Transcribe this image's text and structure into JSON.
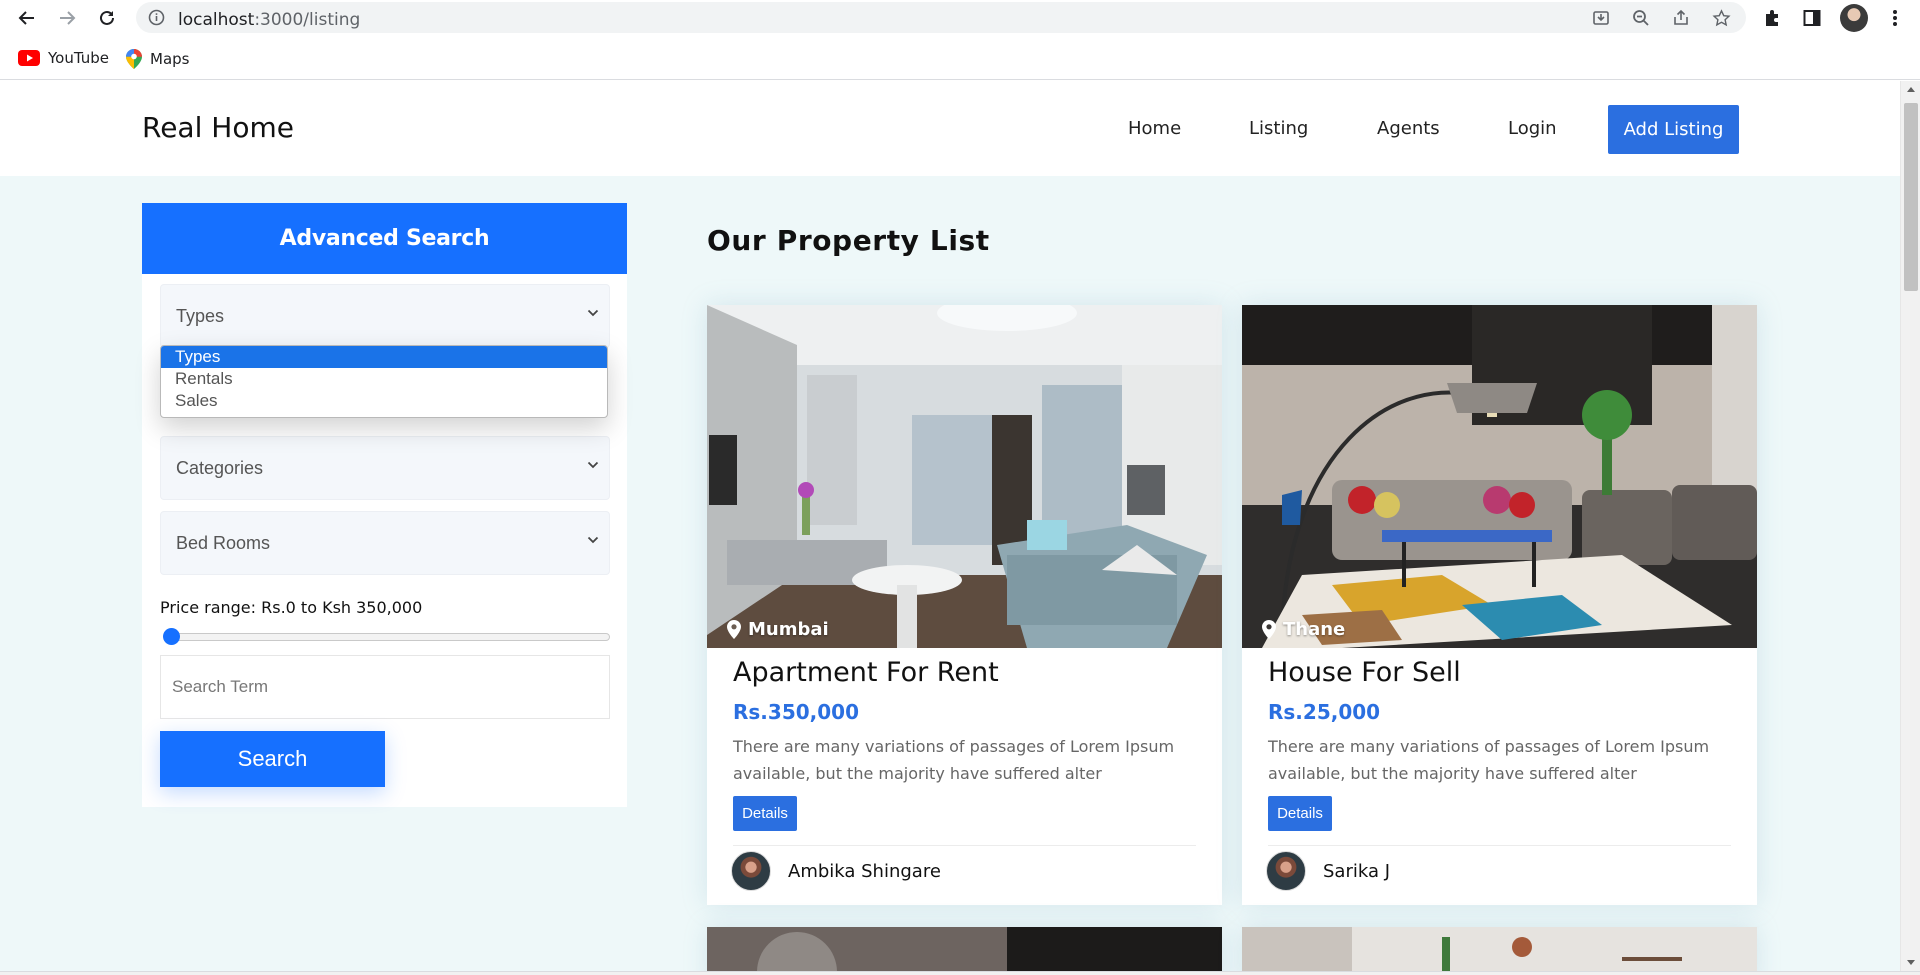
{
  "browser": {
    "url_host": "localhost",
    "url_path": ":3000/listing",
    "bookmarks": [
      {
        "label": "YouTube",
        "icon": "youtube-icon"
      },
      {
        "label": "Maps",
        "icon": "maps-pin-icon"
      }
    ]
  },
  "header": {
    "brand": "Real Home",
    "nav": [
      "Home",
      "Listing",
      "Agents",
      "Login"
    ],
    "cta": "Add Listing"
  },
  "sidebar": {
    "title": "Advanced Search",
    "types": {
      "value": "Types",
      "options": [
        {
          "label": "Types",
          "selected": true
        },
        {
          "label": "Rentals",
          "selected": false
        },
        {
          "label": "Sales",
          "selected": false
        }
      ]
    },
    "categories": {
      "value": "Categories"
    },
    "bedrooms": {
      "value": "Bed Rooms"
    },
    "price_label": "Price range: Rs.0 to Ksh 350,000",
    "price_slider_fraction": 0,
    "search_placeholder": "Search Term",
    "search_button": "Search"
  },
  "main": {
    "title": "Our Property List",
    "cards": [
      {
        "location": "Mumbai",
        "title": "Apartment For Rent",
        "price": "Rs.350,000",
        "description": "There are many variations of passages of Lorem Ipsum available, but the majority have suffered alter",
        "details_button": "Details",
        "agent": "Ambika Shingare"
      },
      {
        "location": "Thane",
        "title": "House For Sell",
        "price": "Rs.25,000",
        "description": "There are many variations of passages of Lorem Ipsum available, but the majority have suffered alter",
        "details_button": "Details",
        "agent": "Sarika J"
      }
    ]
  },
  "colors": {
    "primary": "#1670ff",
    "accent": "#2b6fe0",
    "page_bg": "#eef8f9"
  }
}
